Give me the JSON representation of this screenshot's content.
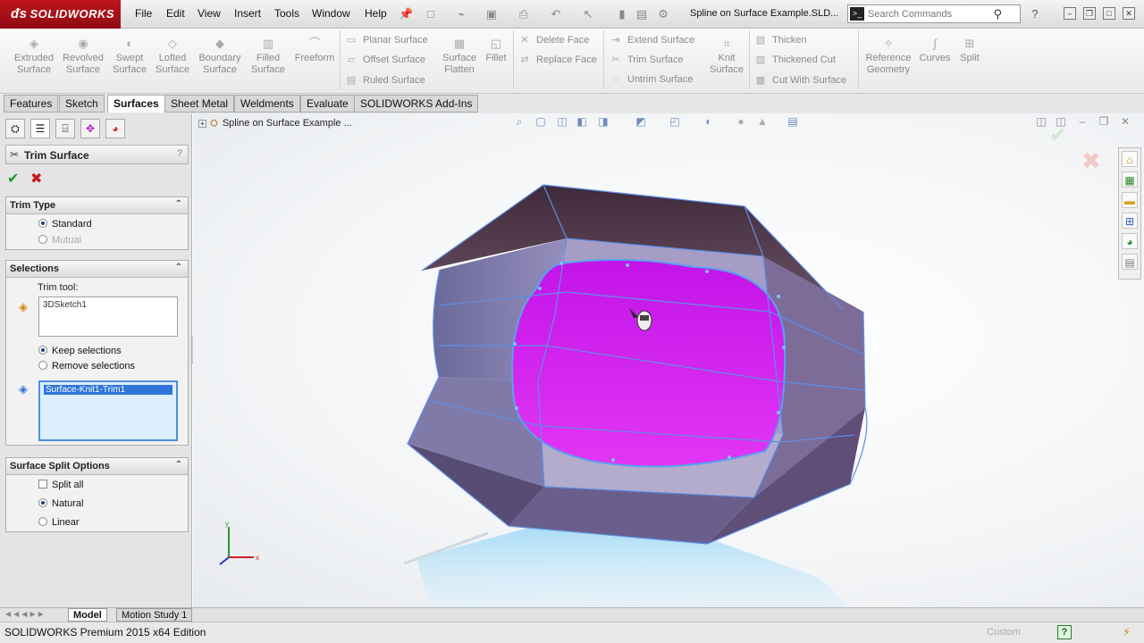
{
  "app": {
    "brand": "SOLIDWORKS",
    "menus": [
      "File",
      "Edit",
      "View",
      "Insert",
      "Tools",
      "Window",
      "Help"
    ],
    "document_title": "Spline on Surface Example.SLD...",
    "search_placeholder": "Search Commands"
  },
  "ribbon": {
    "big_buttons": [
      {
        "label1": "Extruded",
        "label2": "Surface",
        "icon": "extruded-surface-icon"
      },
      {
        "label1": "Revolved",
        "label2": "Surface",
        "icon": "revolved-surface-icon"
      },
      {
        "label1": "Swept",
        "label2": "Surface",
        "icon": "swept-surface-icon"
      },
      {
        "label1": "Lofted",
        "label2": "Surface",
        "icon": "lofted-surface-icon"
      },
      {
        "label1": "Boundary",
        "label2": "Surface",
        "icon": "boundary-surface-icon"
      },
      {
        "label1": "Filled",
        "label2": "Surface",
        "icon": "filled-surface-icon"
      },
      {
        "label1": "Freeform",
        "label2": "",
        "icon": "freeform-icon"
      }
    ],
    "surface_group": [
      "Planar Surface",
      "Offset Surface",
      "Ruled Surface"
    ],
    "flatten": {
      "label1": "Surface",
      "label2": "Flatten"
    },
    "fillet": "Fillet",
    "face_group": [
      "Delete Face",
      "Replace Face"
    ],
    "extend_group": [
      "Extend Surface",
      "Trim Surface",
      "Untrim Surface"
    ],
    "knit": {
      "label1": "Knit",
      "label2": "Surface"
    },
    "thicken_group": [
      "Thicken",
      "Thickened Cut",
      "Cut With Surface"
    ],
    "ref_geometry": {
      "label1": "Reference",
      "label2": "Geometry"
    },
    "curves": "Curves",
    "split": "Split"
  },
  "tabs": [
    "Features",
    "Sketch",
    "Surfaces",
    "Sheet Metal",
    "Weldments",
    "Evaluate",
    "SOLIDWORKS Add-Ins"
  ],
  "active_tab": "Surfaces",
  "property_manager": {
    "title": "Trim Surface",
    "help": "?",
    "trim_type": {
      "heading": "Trim Type",
      "options": [
        "Standard",
        "Mutual"
      ],
      "selected": "Standard"
    },
    "selections": {
      "heading": "Selections",
      "trim_tool_label": "Trim tool:",
      "trim_tool_value": "3DSketch1",
      "keep_label": "Keep selections",
      "remove_label": "Remove selections",
      "selected_option": "Keep selections",
      "kept_body": "Surface-Knit1-Trim1"
    },
    "split_options": {
      "heading": "Surface Split Options",
      "split_all": "Split all",
      "natural": "Natural",
      "linear": "Linear",
      "selected": "Natural"
    }
  },
  "viewport": {
    "tree_label": "Spline on Surface Example  ...",
    "accent_magenta": "#d21cf0",
    "surface_color": "#8a7fb0"
  },
  "bottom_tabs": [
    "Model",
    "Motion Study 1"
  ],
  "active_bottom_tab": "Model",
  "status": {
    "edition": "SOLIDWORKS Premium 2015 x64 Edition",
    "custom": "Custom",
    "help": "?"
  }
}
